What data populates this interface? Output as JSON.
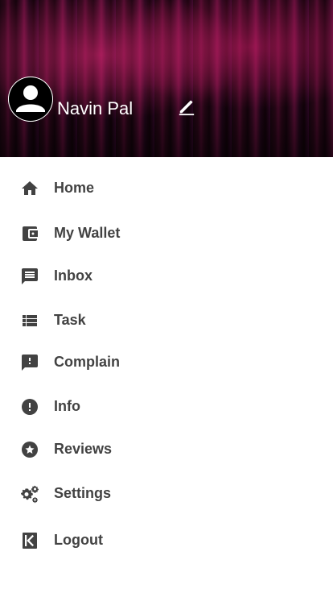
{
  "drawer_header": {
    "user_name": "Navin Pal",
    "avatar_icon": "account-circle-icon",
    "edit_icon": "edit-pencil-icon"
  },
  "menu": {
    "items": [
      {
        "label": "Home",
        "icon": "home-icon"
      },
      {
        "label": "My Wallet",
        "icon": "wallet-icon"
      },
      {
        "label": "Inbox",
        "icon": "message-icon"
      },
      {
        "label": "Task",
        "icon": "list-icon"
      },
      {
        "label": "Complain",
        "icon": "feedback-icon"
      },
      {
        "label": "Info",
        "icon": "info-icon"
      },
      {
        "label": "Reviews",
        "icon": "star-badge-icon"
      },
      {
        "label": "Settings",
        "icon": "gears-icon"
      },
      {
        "label": "Logout",
        "icon": "logout-icon"
      }
    ]
  },
  "colors": {
    "icon": "#424242",
    "label": "#424242",
    "header_name": "#ffffff"
  }
}
